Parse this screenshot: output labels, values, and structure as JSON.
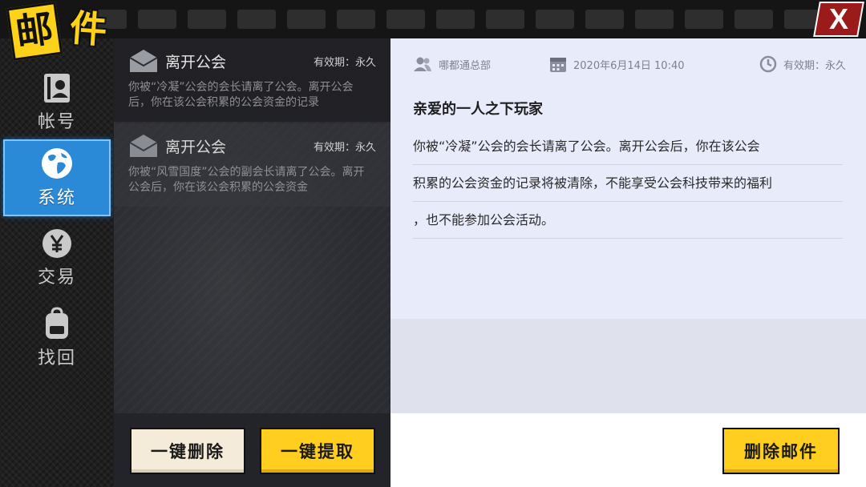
{
  "header": {
    "title_char1": "邮",
    "title_char2": "件",
    "close_label": "X"
  },
  "sidebar": {
    "items": [
      {
        "label": "帐号",
        "icon": "contact-card-icon",
        "active": false
      },
      {
        "label": "系统",
        "icon": "globe-icon",
        "active": true
      },
      {
        "label": "交易",
        "icon": "yen-coin-icon",
        "active": false
      },
      {
        "label": "找回",
        "icon": "backpack-icon",
        "active": false
      }
    ]
  },
  "mail_list": {
    "items": [
      {
        "subject": "离开公会",
        "validity": "有效期：永久",
        "preview": "你被“冷凝”公会的会长请离了公会。离开公会后，你在该公会积累的公会资金的记录"
      },
      {
        "subject": "离开公会",
        "validity": "有效期：永久",
        "preview": "你被“风雪国度”公会的副会长请离了公会。离开公会后，你在该公会积累的公会资金"
      }
    ],
    "delete_all_label": "一键删除",
    "claim_all_label": "一键提取"
  },
  "detail": {
    "sender": "哪都通总部",
    "date": "2020年6月14日  10:40",
    "validity": "有效期：永久",
    "greeting": "亲爱的一人之下玩家",
    "body_lines": [
      "你被“冷凝”公会的会长请离了公会。离开公会后，你在该公会",
      "积累的公会资金的记录将被清除，不能享受公会科技带来的福利",
      "，也不能参加公会活动。"
    ],
    "delete_label": "删除邮件"
  },
  "colors": {
    "accent_yellow": "#ffce1f",
    "active_blue": "#2a8ad8",
    "close_red": "#9b1b1b"
  }
}
